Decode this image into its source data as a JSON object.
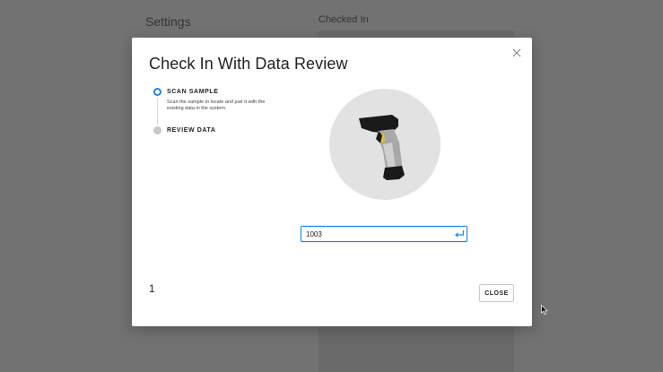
{
  "background": {
    "settings_title": "Settings",
    "checked_in_title": "Checked In"
  },
  "modal": {
    "title": "Check In With Data Review",
    "close_icon": "close-icon",
    "steps": [
      {
        "label": "SCAN SAMPLE",
        "description": "Scan the sample to locate and pair it with the existing data in the system.",
        "state": "active"
      },
      {
        "label": "REVIEW DATA",
        "state": "inactive"
      }
    ],
    "illustration": "barcode-scanner-icon",
    "input": {
      "value": "1003",
      "enter_icon": "enter-icon"
    },
    "page_number": "1",
    "close_button": "CLOSE"
  },
  "colors": {
    "accent": "#1e88e5",
    "inactive_step": "#c8c8c8",
    "illustration_bg": "#e2e2e2",
    "scanner_trigger": "#e6c229"
  }
}
